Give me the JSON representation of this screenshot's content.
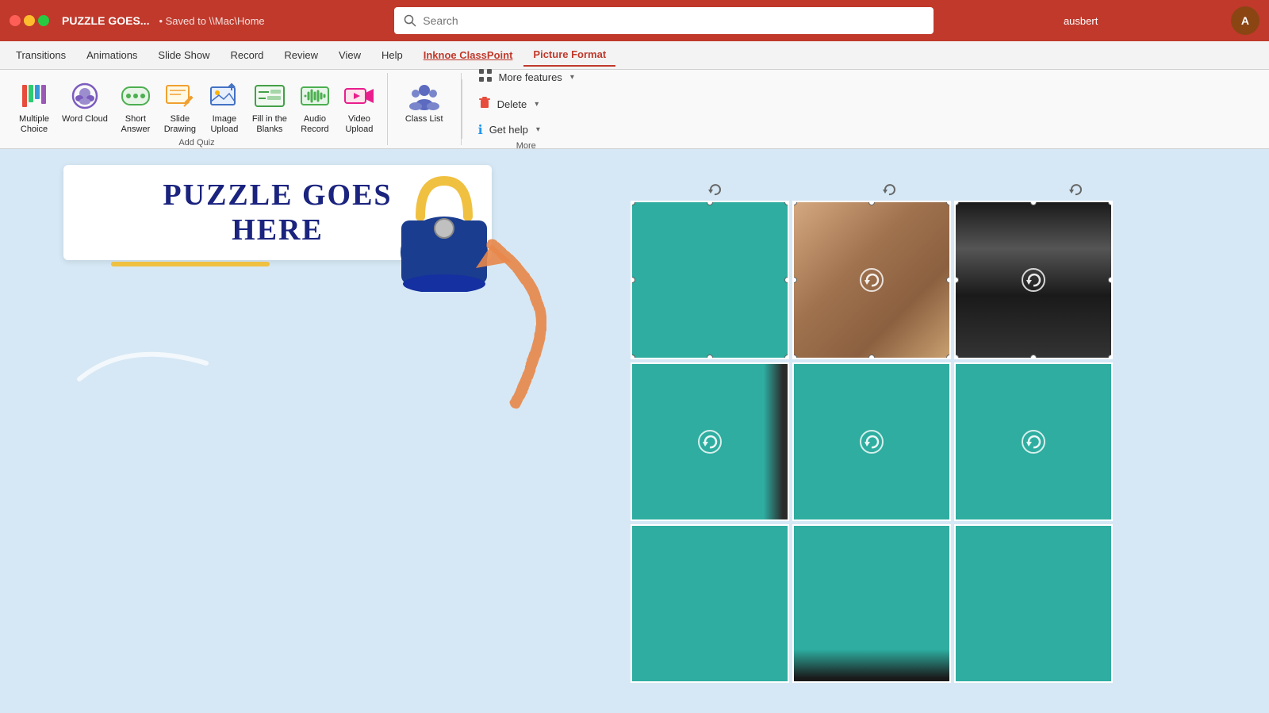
{
  "titlebar": {
    "title": "PUZZLE GOES...",
    "save_indicator": "• Saved to \\\\Mac\\Home",
    "search_placeholder": "Search",
    "username": "ausbert",
    "avatar_initials": "A"
  },
  "ribbon_tabs": [
    {
      "label": "Transitions",
      "active": false
    },
    {
      "label": "Animations",
      "active": false
    },
    {
      "label": "Slide Show",
      "active": false
    },
    {
      "label": "Record",
      "active": false
    },
    {
      "label": "Review",
      "active": false
    },
    {
      "label": "View",
      "active": false
    },
    {
      "label": "Help",
      "active": false
    },
    {
      "label": "Inknoe ClassPoint",
      "active": true,
      "classpoint": true
    },
    {
      "label": "Picture Format",
      "active": true,
      "pictureformat": true
    }
  ],
  "ribbon": {
    "quiz_group_label": "Add Quiz",
    "more_group_label": "More",
    "buttons": [
      {
        "id": "multiple-choice",
        "label": "Multiple\nChoice",
        "icon": "mc"
      },
      {
        "id": "word-cloud",
        "label": "Word Cloud",
        "icon": "cloud"
      },
      {
        "id": "short-answer",
        "label": "Short\nAnswer",
        "icon": "chat"
      },
      {
        "id": "slide-drawing",
        "label": "Slide\nDrawing",
        "icon": "pencil"
      },
      {
        "id": "image-upload",
        "label": "Image\nUpload",
        "icon": "image"
      },
      {
        "id": "fill-blanks",
        "label": "Fill in the\nBlanks",
        "icon": "blanks"
      },
      {
        "id": "audio-record",
        "label": "Audio\nRecord",
        "icon": "audio"
      },
      {
        "id": "video-upload",
        "label": "Video\nUpload",
        "icon": "video"
      },
      {
        "id": "class-list",
        "label": "Class List",
        "icon": "classlist"
      }
    ],
    "more_buttons": [
      {
        "id": "more-features",
        "label": "More features",
        "icon": "grid",
        "has_chevron": true
      },
      {
        "id": "delete",
        "label": "Delete",
        "icon": "trash",
        "has_chevron": true
      },
      {
        "id": "get-help",
        "label": "Get help",
        "icon": "info",
        "has_chevron": true
      }
    ]
  },
  "slide": {
    "title_line1": "PUZZLE GOES",
    "title_line2": "HERE"
  },
  "dropdown": {
    "items": [
      {
        "id": "more-features",
        "label": "More features",
        "icon": "grid",
        "has_chevron": true
      },
      {
        "id": "delete",
        "label": "Delete",
        "icon": "trash",
        "has_chevron": true
      },
      {
        "id": "get-help",
        "label": "Get help",
        "icon": "info",
        "has_chevron": true
      }
    ]
  }
}
